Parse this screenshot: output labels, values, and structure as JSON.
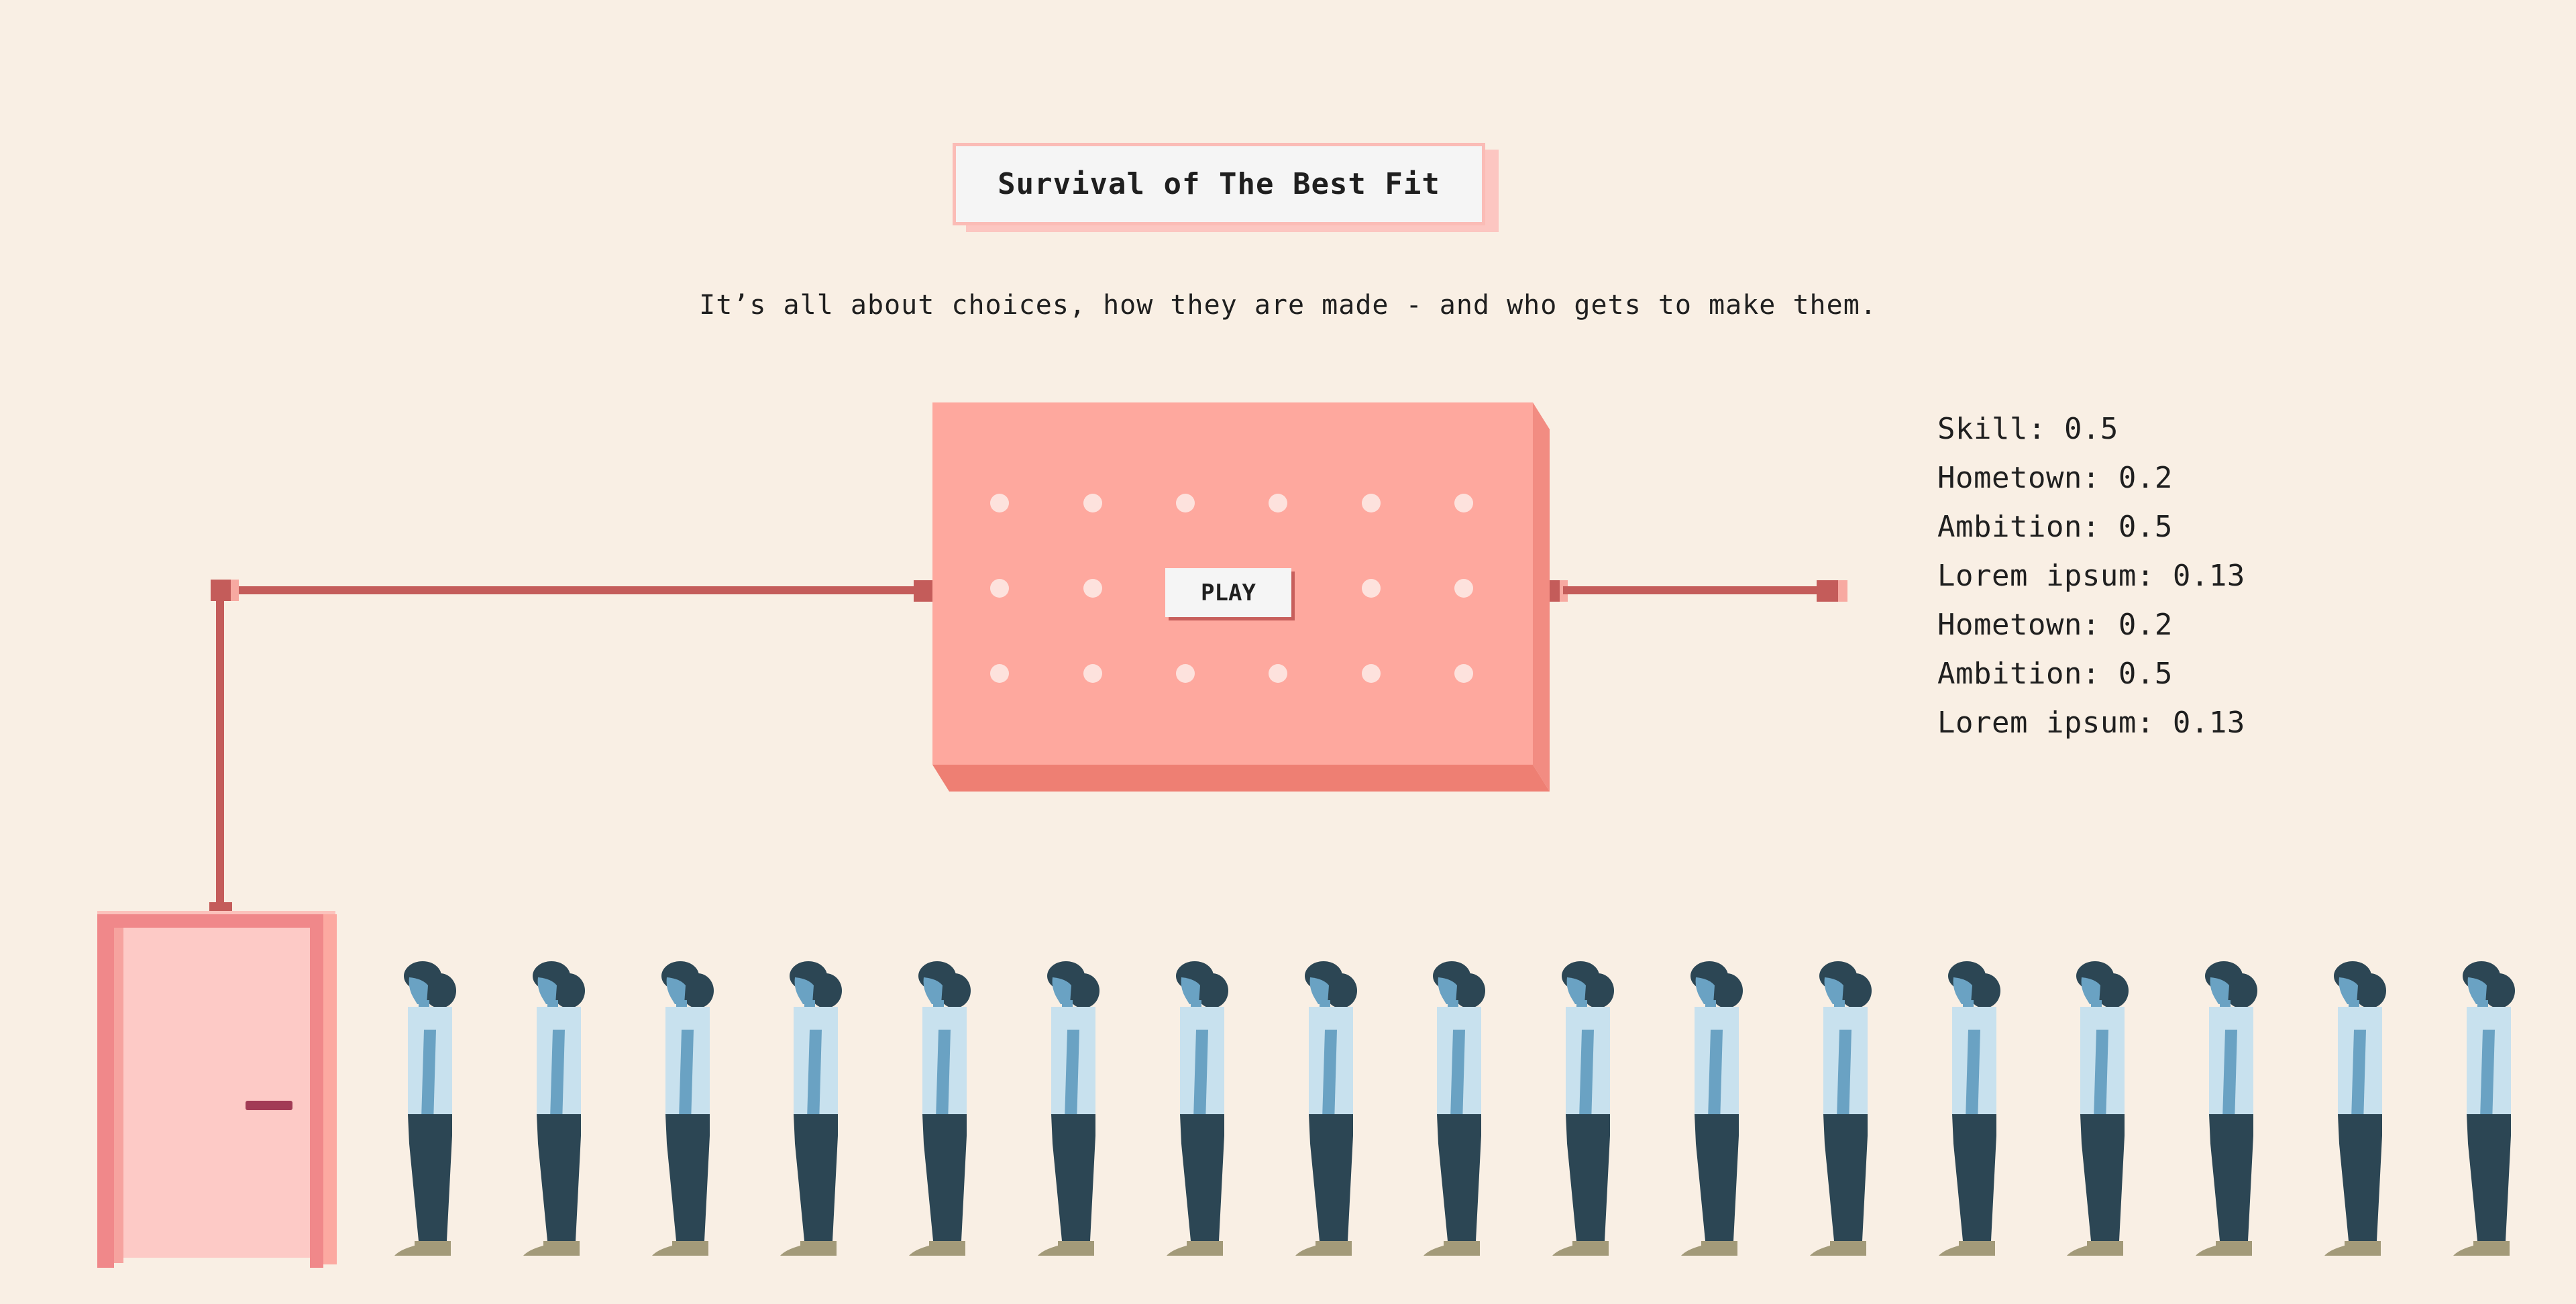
{
  "header": {
    "title": "Survival of The Best Fit",
    "subtitle": "It’s all about choices, how they are made - and who gets to make them."
  },
  "machine": {
    "play_label": "PLAY"
  },
  "stats": [
    {
      "label": "Skill",
      "value": "0.5"
    },
    {
      "label": "Hometown",
      "value": "0.2"
    },
    {
      "label": "Ambition",
      "value": "0.5"
    },
    {
      "label": "Lorem ipsum",
      "value": "0.13"
    },
    {
      "label": "Hometown",
      "value": "0.2"
    },
    {
      "label": "Ambition",
      "value": "0.5"
    },
    {
      "label": "Lorem ipsum",
      "value": "0.13"
    }
  ],
  "queue": {
    "candidate_count": 17
  },
  "colors": {
    "background": "#f9efe4",
    "machine": "#fea89e",
    "pipe": "#c45c5a",
    "door": "#f0888a",
    "shirt": "#c8e1ee",
    "pants": "#2c4654",
    "skin": "#6aa2c3"
  }
}
